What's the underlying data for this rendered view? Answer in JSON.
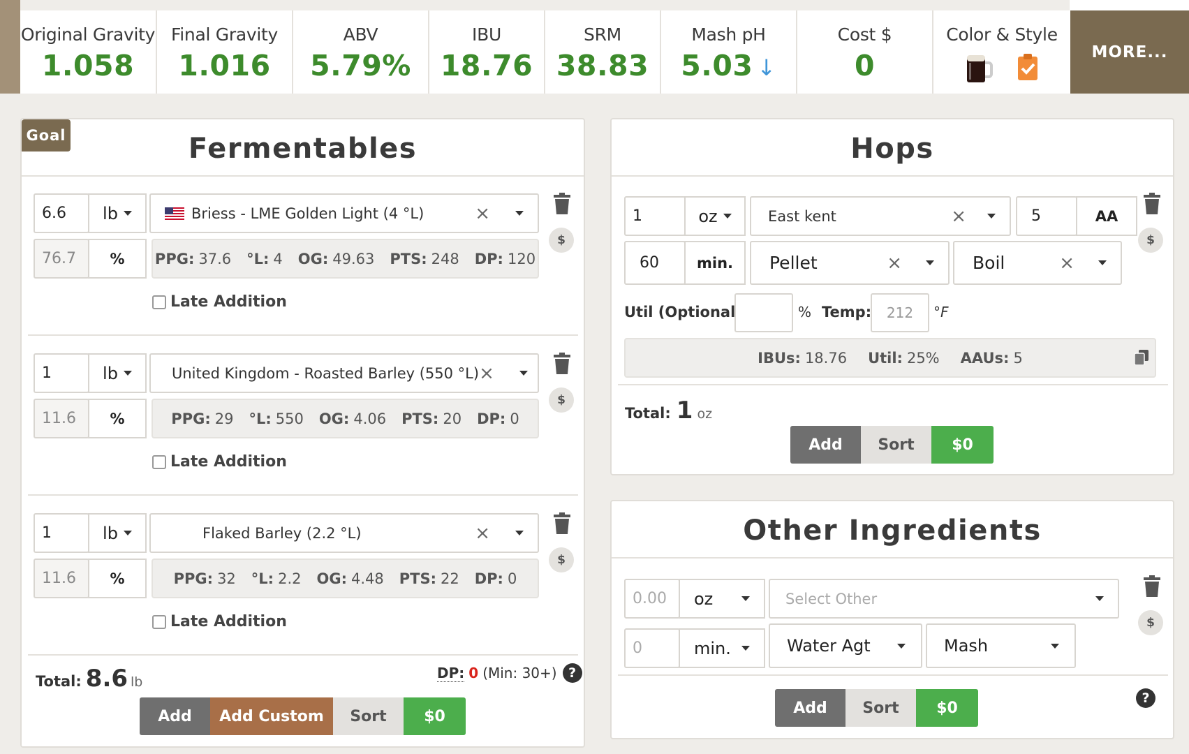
{
  "stats": [
    {
      "label": "Original Gravity",
      "value": "1.058"
    },
    {
      "label": "Final Gravity",
      "value": "1.016"
    },
    {
      "label": "ABV",
      "value": "5.79%"
    },
    {
      "label": "IBU",
      "value": "18.76"
    },
    {
      "label": "SRM",
      "value": "38.83"
    },
    {
      "label": "Mash pH",
      "value": "5.03",
      "arrow": "↓"
    },
    {
      "label": "Cost $",
      "value": "0"
    },
    {
      "label": "Color & Style",
      "value": ""
    }
  ],
  "more_label": "MORE...",
  "fermentables": {
    "goal_badge": "Goal",
    "title": "Fermentables",
    "items": [
      {
        "amount": "6.6",
        "unit": "lb",
        "name": "Briess - LME Golden Light (4 °L)",
        "flag": "us-flag",
        "percent": "76.7",
        "percent_sign": "%",
        "ppg": "37.6",
        "lov": "4",
        "og": "49.63",
        "pts": "248",
        "dp": "120",
        "late": "Late Addition"
      },
      {
        "amount": "1",
        "unit": "lb",
        "name": "United Kingdom - Roasted Barley (550 °L)",
        "flag": "uk-flag",
        "percent": "11.6",
        "percent_sign": "%",
        "ppg": "29",
        "lov": "550",
        "og": "4.06",
        "pts": "20",
        "dp": "0",
        "late": "Late Addition"
      },
      {
        "amount": "1",
        "unit": "lb",
        "name": "Flaked Barley (2.2 °L)",
        "flag": "",
        "percent": "11.6",
        "percent_sign": "%",
        "ppg": "32",
        "lov": "2.2",
        "og": "4.48",
        "pts": "22",
        "dp": "0",
        "late": "Late Addition"
      }
    ],
    "labels": {
      "ppg": "PPG:",
      "lov": "°L:",
      "og": "OG:",
      "pts": "PTS:",
      "dp": "DP:"
    },
    "total_label": "Total:",
    "total_value": "8.6",
    "total_unit": "lb",
    "dp_label": "DP:",
    "dp_value": "0",
    "dp_min": "(Min: 30+)",
    "buttons": {
      "add": "Add",
      "add_custom": "Add Custom",
      "sort": "Sort",
      "cost": "$0"
    }
  },
  "hops": {
    "title": "Hops",
    "amount": "1",
    "unit": "oz",
    "name": "East kent",
    "aa_value": "5",
    "aa_label": "AA",
    "time": "60",
    "time_unit": "min.",
    "form": "Pellet",
    "use": "Boil",
    "util_label": "Util (Optional):",
    "util_value": "",
    "pct": "%",
    "temp_label": "Temp:",
    "temp_placeholder": "212",
    "temp_unit": "°F",
    "ibus_label": "IBUs:",
    "ibus": "18.76",
    "util_label2": "Util:",
    "util": "25%",
    "aaus_label": "AAUs:",
    "aaus": "5",
    "total_label": "Total:",
    "total_value": "1",
    "total_unit": "oz",
    "buttons": {
      "add": "Add",
      "sort": "Sort",
      "cost": "$0"
    }
  },
  "other": {
    "title": "Other Ingredients",
    "amount_placeholder": "0.00",
    "unit": "oz",
    "select_placeholder": "Select Other",
    "time_placeholder": "0",
    "time_unit": "min.",
    "type": "Water Agt",
    "use": "Mash",
    "buttons": {
      "add": "Add",
      "sort": "Sort",
      "cost": "$0"
    }
  },
  "help_icon": "?"
}
